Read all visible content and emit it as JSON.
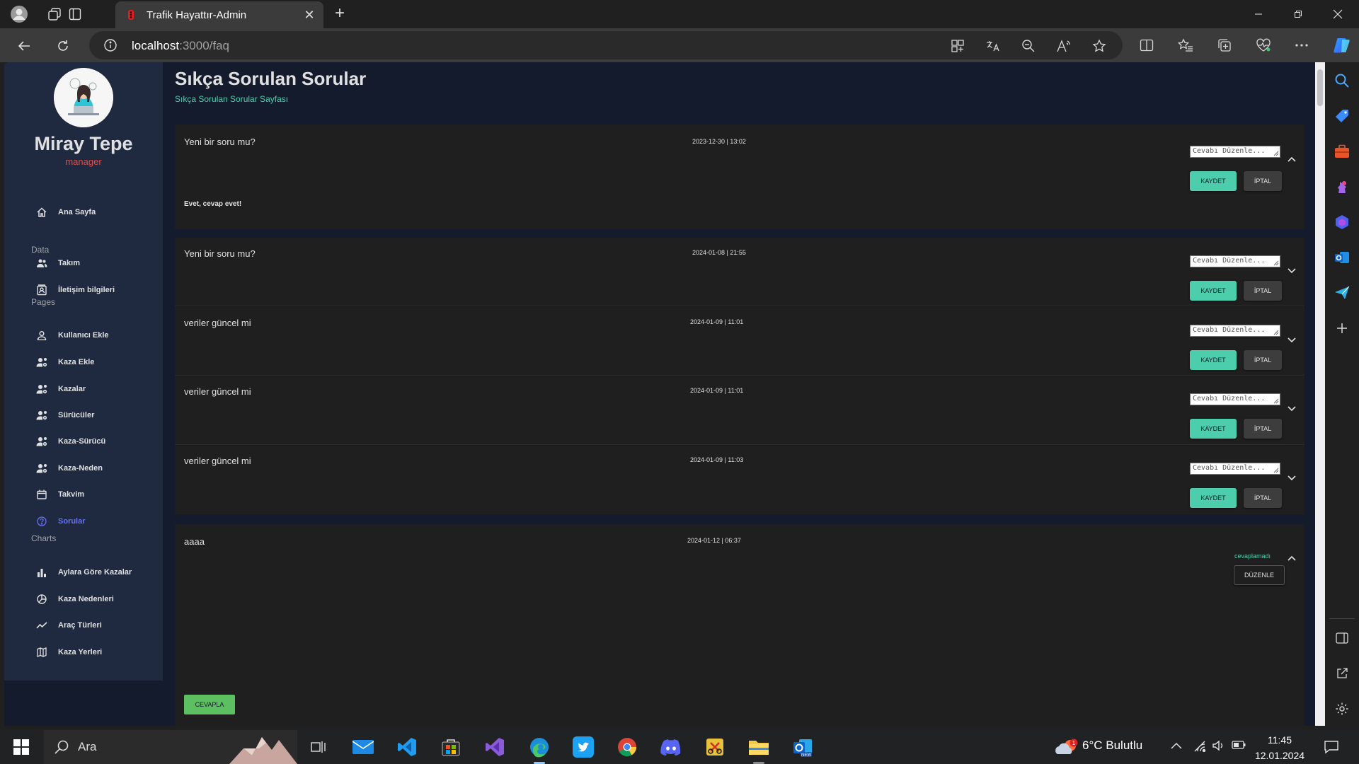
{
  "browser": {
    "tab_title": "Trafik Hayattır-Admin",
    "url_host": "localhost",
    "url_path": ":3000/faq"
  },
  "sidebar": {
    "user_name": "Miray Tepe",
    "user_role": "manager",
    "items": [
      {
        "label": "Ana Sayfa",
        "icon": "home-icon"
      },
      {
        "section": "Data"
      },
      {
        "label": "Takım",
        "icon": "people-icon"
      },
      {
        "label": "İletişim bilgileri",
        "icon": "contacts-icon"
      },
      {
        "section": "Pages"
      },
      {
        "label": "Kullanıcı Ekle",
        "icon": "person-icon"
      },
      {
        "label": "Kaza Ekle",
        "icon": "person-settings-icon"
      },
      {
        "label": "Kazalar",
        "icon": "person-settings-icon"
      },
      {
        "label": "Sürücüler",
        "icon": "person-settings-icon"
      },
      {
        "label": "Kaza-Sürücü",
        "icon": "person-settings-icon"
      },
      {
        "label": "Kaza-Neden",
        "icon": "person-settings-icon"
      },
      {
        "label": "Takvim",
        "icon": "calendar-icon"
      },
      {
        "label": "Sorular",
        "icon": "help-icon",
        "active": true
      },
      {
        "section": "Charts"
      },
      {
        "label": "Aylara Göre Kazalar",
        "icon": "bar-chart-icon"
      },
      {
        "label": "Kaza Nedenleri",
        "icon": "pie-chart-icon"
      },
      {
        "label": "Araç Türleri",
        "icon": "line-chart-icon"
      },
      {
        "label": "Kaza Yerleri",
        "icon": "map-icon"
      }
    ]
  },
  "page": {
    "title": "Sıkça Sorulan Sorular",
    "subtitle": "Sıkça Sorulan Sorular Sayfası"
  },
  "faq": [
    {
      "question": "Yeni bir soru mu?",
      "date": "2023-12-30 | 13:02",
      "answer": "Evet, cevap evet!",
      "expanded": true
    },
    {
      "question": "Yeni bir soru mu?",
      "date": "2024-01-08 | 21:55",
      "expanded": false
    },
    {
      "question": "veriler güncel mi",
      "date": "2024-01-09 | 11:01",
      "expanded": false
    },
    {
      "question": "veriler güncel mi",
      "date": "2024-01-09 | 11:01",
      "expanded": false
    },
    {
      "question": "veriler güncel mi",
      "date": "2024-01-09 | 11:03",
      "expanded": false
    }
  ],
  "faq_editor": {
    "placeholder": "Cevabı Düzenle...",
    "save_label": "KAYDET",
    "cancel_label": "İPTAL"
  },
  "pending_question": {
    "question": "aaaa",
    "date": "2024-01-12 | 06:37",
    "status": "cevaplamadı",
    "edit_label": "DÜZENLE",
    "reply_label": "CEVAPLA"
  },
  "taskbar": {
    "search_label": "Ara",
    "weather": "6°C  Bulutlu",
    "weather_badge": "1",
    "time": "11:45",
    "date": "12.01.2024"
  },
  "colors": {
    "accent_green": "#4cceac",
    "accent_purple": "#6870fa",
    "role_red": "#db4f4a",
    "page_bg": "#141b2d",
    "sidebar_bg": "#1f2a40"
  }
}
